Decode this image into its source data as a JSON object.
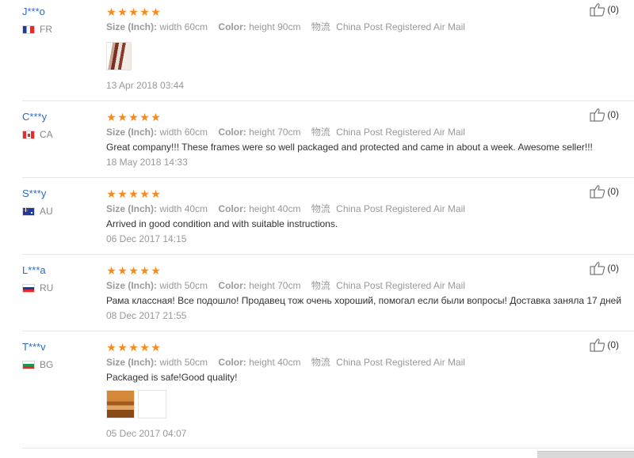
{
  "labels": {
    "size": "Size (Inch):",
    "color": "Color:",
    "ship_cn": "物流"
  },
  "reviews": [
    {
      "user": "J***o",
      "country": "FR",
      "size": "width 60cm",
      "color": "height 90cm",
      "shipping": "China Post Registered Air Mail",
      "comment": "",
      "date": "13 Apr 2018 03:44",
      "likes": "(0)"
    },
    {
      "user": "C***y",
      "country": "CA",
      "size": "width 60cm",
      "color": "height 70cm",
      "shipping": "China Post Registered Air Mail",
      "comment": "Great company!!! These frames were so well packaged and protected and came in about a week. Awesome seller!!!",
      "date": "18 May 2018 14:33",
      "likes": "(0)"
    },
    {
      "user": "S***y",
      "country": "AU",
      "size": "width 40cm",
      "color": "height 40cm",
      "shipping": "China Post Registered Air Mail",
      "comment": "Arrived in good condition and with suitable instructions.",
      "date": "06 Dec 2017 14:15",
      "likes": "(0)"
    },
    {
      "user": "L***a",
      "country": "RU",
      "size": "width 50cm",
      "color": "height 70cm",
      "shipping": "China Post Registered Air Mail",
      "comment": "Рама классная! Все подошло! Продавец тож очень хороший, помогал если были вопросы! Доставка заняла 17 дней",
      "date": "08 Dec 2017 21:55",
      "likes": "(0)"
    },
    {
      "user": "T***v",
      "country": "BG",
      "size": "width 50cm",
      "color": "height 40cm",
      "shipping": "China Post Registered Air Mail",
      "comment": "Packaged is safe!Good quality!",
      "date": "05 Dec 2017 04:07",
      "likes": "(0)"
    }
  ],
  "colors": {
    "username": "#2a6cc4",
    "star": "#f58a1f",
    "muted": "#999999"
  },
  "icons": {
    "star": "star-icon",
    "like": "thumbs-up-icon",
    "flag": "country-flag-icon"
  }
}
